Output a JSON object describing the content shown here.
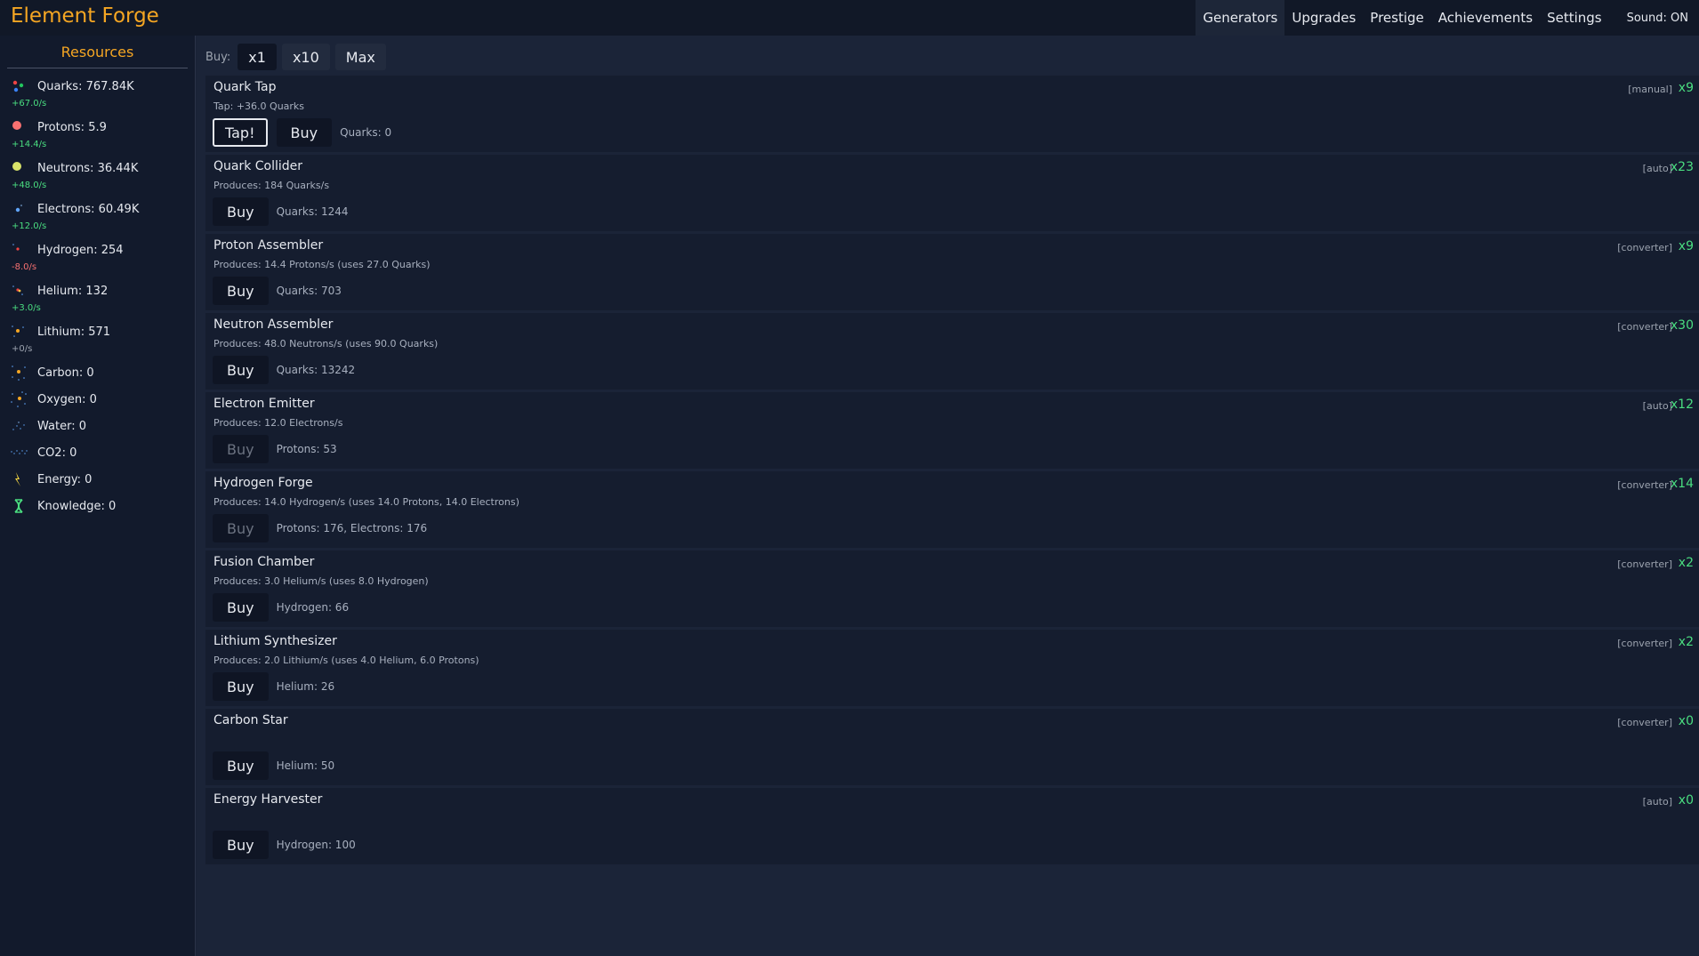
{
  "app": {
    "title": "Element Forge"
  },
  "nav": {
    "items": [
      {
        "label": "Generators",
        "active": true
      },
      {
        "label": "Upgrades"
      },
      {
        "label": "Prestige"
      },
      {
        "label": "Achievements"
      },
      {
        "label": "Settings"
      }
    ],
    "sound": "Sound: ON"
  },
  "sidebar": {
    "header": "Resources",
    "resources": [
      {
        "name": "Quarks: 767.84K",
        "rate": "+67.0/s",
        "rate_type": "pos",
        "icon": "quark-icon"
      },
      {
        "name": "Protons: 5.9",
        "rate": "+14.4/s",
        "rate_type": "pos",
        "icon": "proton-icon"
      },
      {
        "name": "Neutrons: 36.44K",
        "rate": "+48.0/s",
        "rate_type": "pos",
        "icon": "neutron-icon"
      },
      {
        "name": "Electrons: 60.49K",
        "rate": "+12.0/s",
        "rate_type": "pos",
        "icon": "electron-icon"
      },
      {
        "name": "Hydrogen: 254",
        "rate": "-8.0/s",
        "rate_type": "neg",
        "icon": "hydrogen-atom-icon"
      },
      {
        "name": "Helium: 132",
        "rate": "+3.0/s",
        "rate_type": "pos",
        "icon": "helium-atom-icon"
      },
      {
        "name": "Lithium: 571",
        "rate": "+0/s",
        "rate_type": "zero",
        "icon": "lithium-atom-icon"
      },
      {
        "name": "Carbon: 0",
        "rate": null,
        "icon": "carbon-atom-icon"
      },
      {
        "name": "Oxygen: 0",
        "rate": null,
        "icon": "oxygen-atom-icon"
      },
      {
        "name": "Water: 0",
        "rate": null,
        "icon": "water-molecule-icon"
      },
      {
        "name": "CO2: 0",
        "rate": null,
        "icon": "co2-molecule-icon"
      },
      {
        "name": "Energy: 0",
        "rate": null,
        "icon": "lightning-icon"
      },
      {
        "name": "Knowledge: 0",
        "rate": null,
        "icon": "dna-icon"
      }
    ]
  },
  "buybar": {
    "label": "Buy:",
    "options": [
      {
        "label": "x1",
        "active": true
      },
      {
        "label": "x10"
      },
      {
        "label": "Max"
      }
    ]
  },
  "generators": [
    {
      "name": "Quark Tap",
      "desc": "Tap: +36.0 Quarks",
      "type": "[manual]",
      "count": "x9",
      "tap_label": "Tap!",
      "buy_label": "Buy",
      "cost": "Quarks: 0",
      "affordable": true
    },
    {
      "name": "Quark Collider",
      "desc": "Produces: 184 Quarks/s",
      "type": "[auto]",
      "count": "x23",
      "buy_label": "Buy",
      "cost": "Quarks: 1244",
      "affordable": true
    },
    {
      "name": "Proton Assembler",
      "desc": "Produces: 14.4 Protons/s (uses 27.0 Quarks)",
      "type": "[converter]",
      "count": "x9",
      "buy_label": "Buy",
      "cost": "Quarks: 703",
      "affordable": true
    },
    {
      "name": "Neutron Assembler",
      "desc": "Produces: 48.0 Neutrons/s (uses 90.0 Quarks)",
      "type": "[converter]",
      "count": "x30",
      "buy_label": "Buy",
      "cost": "Quarks: 13242",
      "affordable": true
    },
    {
      "name": "Electron Emitter",
      "desc": "Produces: 12.0 Electrons/s",
      "type": "[auto]",
      "count": "x12",
      "buy_label": "Buy",
      "cost": "Protons: 53",
      "affordable": false
    },
    {
      "name": "Hydrogen Forge",
      "desc": "Produces: 14.0 Hydrogen/s (uses 14.0 Protons, 14.0 Electrons)",
      "type": "[converter]",
      "count": "x14",
      "buy_label": "Buy",
      "cost": "Protons: 176, Electrons: 176",
      "affordable": false
    },
    {
      "name": "Fusion Chamber",
      "desc": "Produces: 3.0 Helium/s (uses 8.0 Hydrogen)",
      "type": "[converter]",
      "count": "x2",
      "buy_label": "Buy",
      "cost": "Hydrogen: 66",
      "affordable": true
    },
    {
      "name": "Lithium Synthesizer",
      "desc": "Produces: 2.0 Lithium/s (uses 4.0 Helium, 6.0 Protons)",
      "type": "[converter]",
      "count": "x2",
      "buy_label": "Buy",
      "cost": "Helium: 26",
      "affordable": true
    },
    {
      "name": "Carbon Star",
      "desc": "",
      "type": "[converter]",
      "count": "x0",
      "buy_label": "Buy",
      "cost": "Helium: 50",
      "affordable": true
    },
    {
      "name": "Energy Harvester",
      "desc": "",
      "type": "[auto]",
      "count": "x0",
      "buy_label": "Buy",
      "cost": "Hydrogen: 100",
      "affordable": true
    }
  ]
}
